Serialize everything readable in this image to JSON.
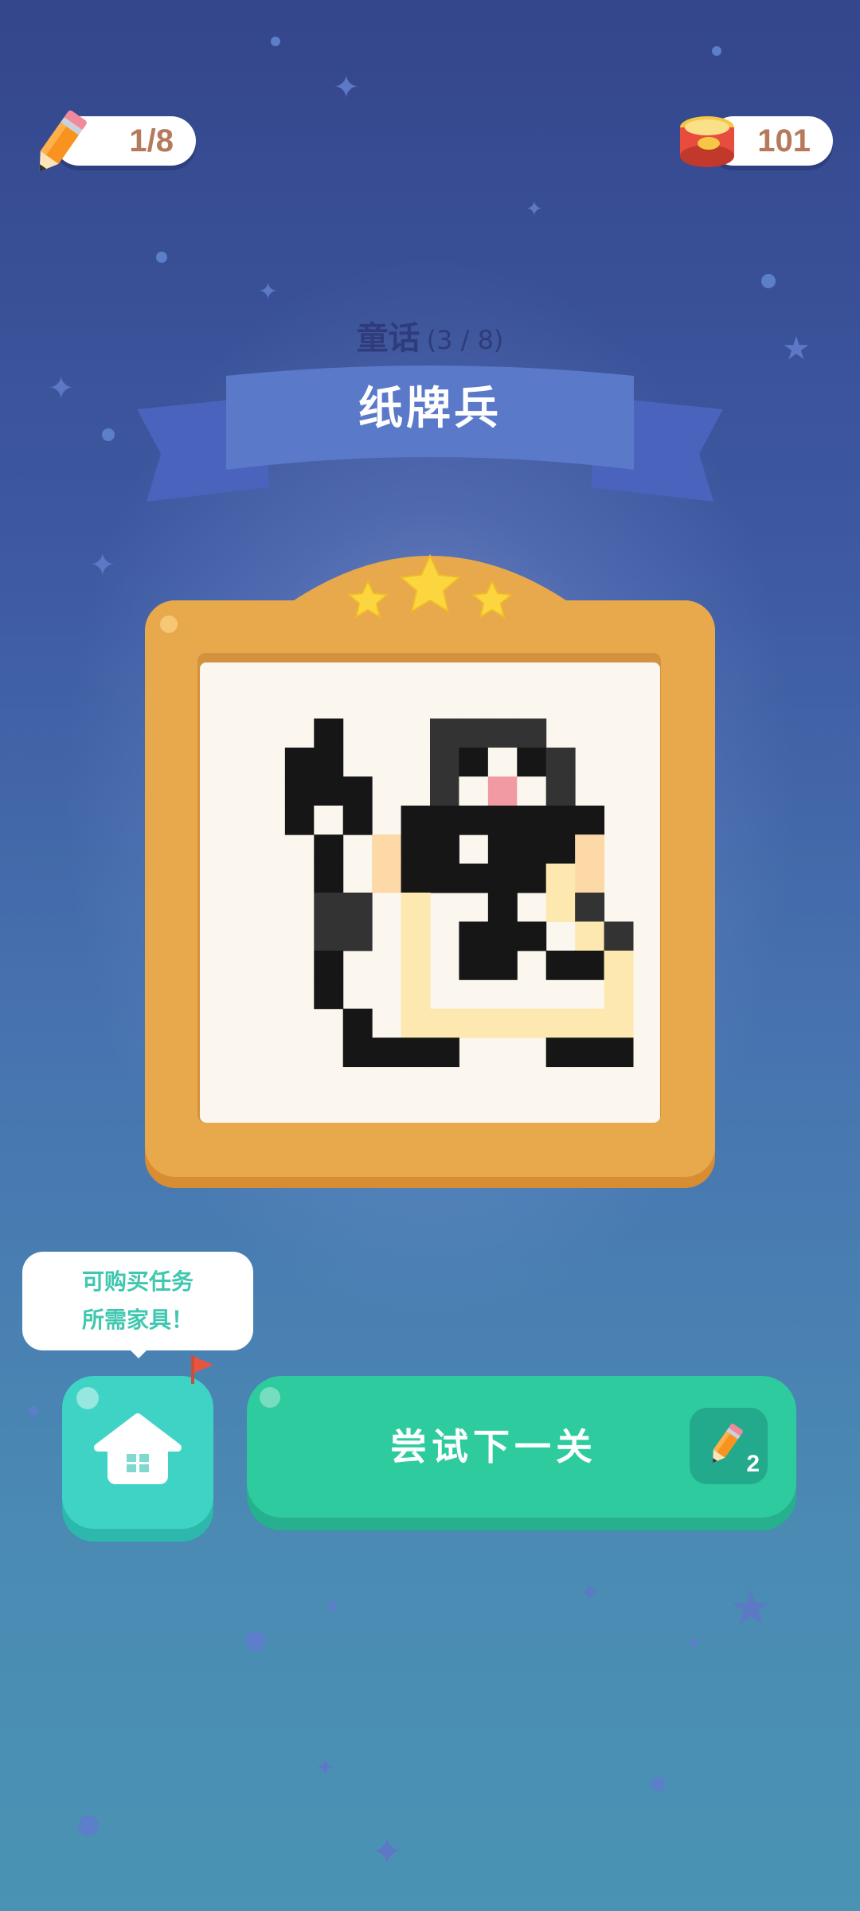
{
  "top_bar": {
    "pencil_count": "1/8",
    "coins": "101"
  },
  "level": {
    "chapter_label": "童话",
    "chapter_progress": "(3 / 8)",
    "title": "纸牌兵",
    "stars_earned": 3,
    "stars_total": 3
  },
  "picture": {
    "grid_size": 14,
    "palette": {
      "k": "#161616",
      "d": "#333333",
      "p": "#f29aa4",
      "w": "#fbf7ee",
      "y": "#fde9b0",
      "o": "#fcd9a6"
    },
    "rows": [
      "..............",
      "...k...dddd...",
      "..kk...dkwkd..",
      "..kkk..dwpwd..",
      "..kwk.kkkkkkk.",
      "...k.okk.kkko.",
      "...k.okkkkkyo.",
      "...dd.y..k.yd.",
      "...dd.y.kkk.yd",
      "...k..y.kk.kky",
      "...k..y......y",
      "....k.yyyyyyyy",
      "....kkkk...kkk",
      ".............."
    ]
  },
  "tip": {
    "line1": "可购买任务",
    "line2": "所需家具！"
  },
  "actions": {
    "home_icon": "home-icon",
    "next_label": "尝试下一关",
    "next_cost": "2"
  },
  "colors": {
    "frame": "#e8a84c",
    "next_button": "#2ecb9f",
    "home_button": "#3fd3c6",
    "ribbon": "#5a79c9"
  }
}
